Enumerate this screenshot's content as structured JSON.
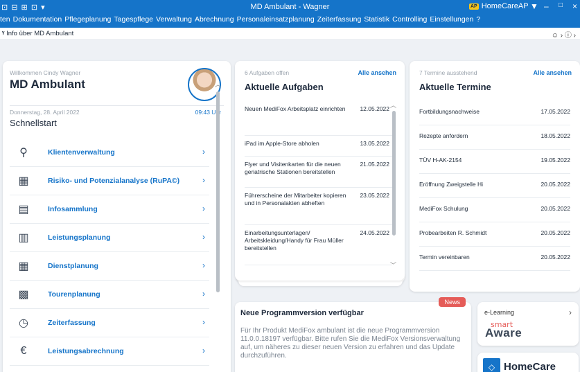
{
  "window": {
    "quick_access": "⊡ ⊟ ⊞ ⊡ ▾",
    "title": "MD Ambulant - Wagner",
    "user_badge": "AP",
    "user": "HomeCareAP",
    "controls": {
      "filter": "▼",
      "minimize": "–",
      "maximize": "□",
      "close": "×"
    }
  },
  "menu": [
    "ten",
    "Dokumentation",
    "Pflegeplanung",
    "Tagespflege",
    "Verwaltung",
    "Abrechnung",
    "Personaleinsatzplanung",
    "Zeiterfassung",
    "Statistik",
    "Controlling",
    "Einstellungen",
    "?"
  ],
  "infobar": {
    "icon": "ᵞ",
    "text": "Info über MD Ambulant",
    "right": "☺ ›   ⓘ ›"
  },
  "welcome": {
    "greeting": "Willkommen Cindy Wagner",
    "brand": "MD Ambulant",
    "date": "Donnerstag, 28. April 2022",
    "time": "09:43 Uhr",
    "section": "Schnellstart"
  },
  "nav": [
    {
      "label": "Klientenverwaltung",
      "icon": "person-icon",
      "glyph": "⚲"
    },
    {
      "label": "Risiko- und Potenzialanalyse (RuPA©)",
      "icon": "analysis-icon",
      "glyph": "▦"
    },
    {
      "label": "Infosammlung",
      "icon": "document-info-icon",
      "glyph": "▤"
    },
    {
      "label": "Leistungsplanung",
      "icon": "clipboard-icon",
      "glyph": "▥"
    },
    {
      "label": "Dienstplanung",
      "icon": "schedule-icon",
      "glyph": "▦"
    },
    {
      "label": "Tourenplanung",
      "icon": "route-icon",
      "glyph": "▩"
    },
    {
      "label": "Zeiterfassung",
      "icon": "time-tracking-icon",
      "glyph": "◷"
    },
    {
      "label": "Leistungsabrechnung",
      "icon": "invoice-icon",
      "glyph": "€"
    }
  ],
  "chevron": "›",
  "tasks": {
    "count": "6 Aufgaben offen",
    "see_all": "Alle ansehen",
    "title": "Aktuelle Aufgaben",
    "items": [
      {
        "text": "Neuen MediFox Arbeitsplatz einrichten",
        "date": "12.05.2022"
      },
      {
        "text": "iPad im Apple-Store abholen",
        "date": "13.05.2022"
      },
      {
        "text": "Flyer und Visitenkarten für die neuen geriatrische Stationen bereitstellen",
        "date": "21.05.2022"
      },
      {
        "text": "Führerscheine der Mitarbeiter kopieren und in Personalakten abheften",
        "date": "23.05.2022"
      },
      {
        "text": "Einarbeitungsunterlagen/ Arbeitskleidung/Handy für Frau Müller bereitstellen",
        "date": "24.05.2022"
      }
    ]
  },
  "termine": {
    "count": "7 Termine ausstehend",
    "see_all": "Alle ansehen",
    "title": "Aktuelle Termine",
    "items": [
      {
        "text": "Fortbildungsnachweise",
        "date": "17.05.2022"
      },
      {
        "text": "Rezepte anfordern",
        "date": "18.05.2022"
      },
      {
        "text": "TÜV H-AK-2154",
        "date": "19.05.2022"
      },
      {
        "text": "Eröffnung Zweigstelle Hi",
        "date": "20.05.2022"
      },
      {
        "text": "MediFox Schulung",
        "date": "20.05.2022"
      },
      {
        "text": "Probearbeiten R. Schmidt",
        "date": "20.05.2022"
      },
      {
        "text": "Termin vereinbaren",
        "date": "20.05.2022"
      }
    ]
  },
  "news": {
    "badge": "News",
    "title": "Neue Programmversion verfügbar",
    "body": "Für Ihr Produkt MediFox ambulant ist die neue Programmversion 11.0.0.18197 verfügbar. Bitte rufen Sie die MediFox Versionsverwaltung auf, um näheres zu dieser neuen Version zu erfahren und das Update durchzuführen."
  },
  "elearning": {
    "label": "e-Learning",
    "smart": "smart",
    "aware": "Aware"
  },
  "homecare": {
    "text": "HomeCare"
  }
}
